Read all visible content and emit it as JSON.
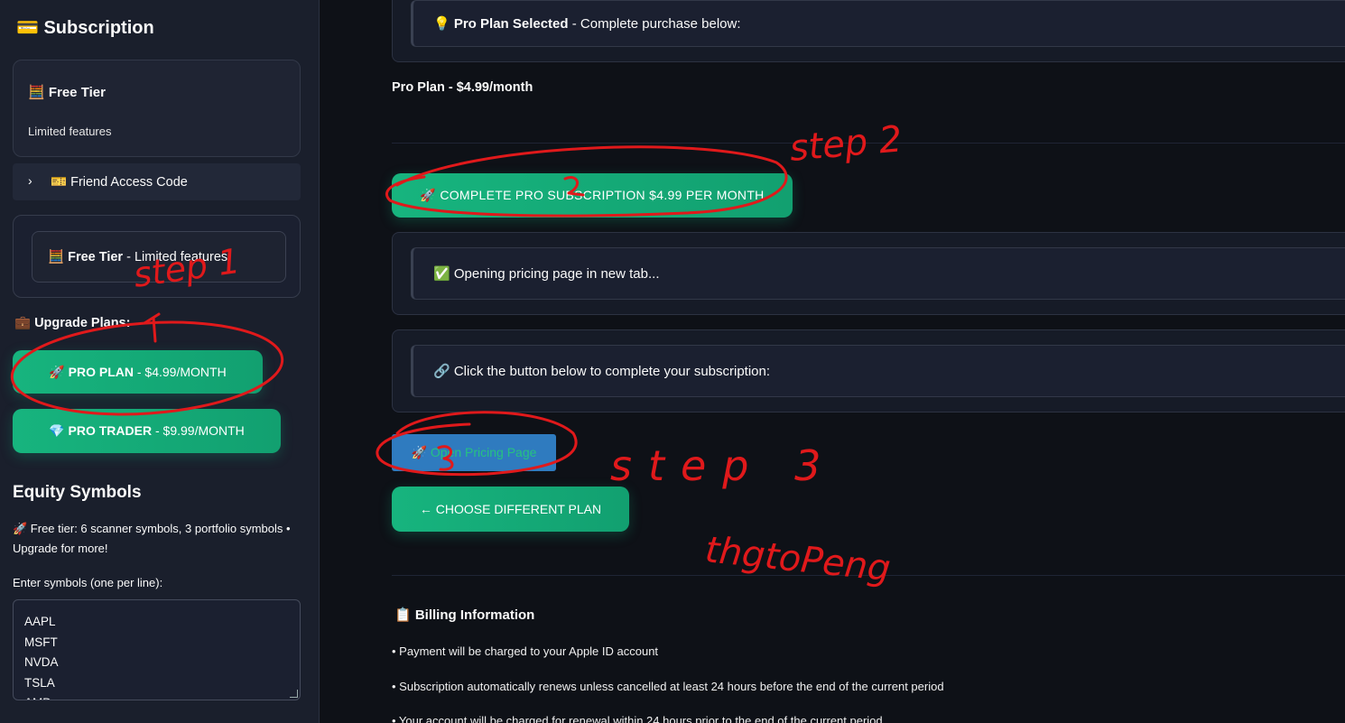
{
  "sidebar": {
    "title": "💳 Subscription",
    "free_card": {
      "title": "🧮 Free Tier",
      "subtitle": "Limited features"
    },
    "friend_access": {
      "chevron": "›",
      "label": "🎫 Friend Access Code"
    },
    "tier_status": {
      "bold": "🧮 Free Tier",
      "rest": " - Limited features"
    },
    "upgrade_heading": "💼 Upgrade Plans:",
    "pro_plan": {
      "name": "🚀 PRO PLAN",
      "price": " - $4.99/MONTH"
    },
    "pro_trader": {
      "name": "💎 PRO TRADER",
      "price": " - $9.99/MONTH"
    },
    "equity": {
      "title": "Equity Symbols",
      "note": "🚀 Free tier: 6 scanner symbols, 3 portfolio symbols • Upgrade for more!",
      "input_label": "Enter symbols (one per line):",
      "symbols": [
        "AAPL",
        "MSFT",
        "NVDA",
        "TSLA",
        "AMD"
      ]
    }
  },
  "main": {
    "selected": {
      "bold": "💡 Pro Plan Selected",
      "rest": " - Complete purchase below:"
    },
    "pro_line": "Pro Plan - $4.99/month",
    "complete_button": "🚀 COMPLETE PRO SUBSCRIPTION $4.99 PER MONTH",
    "opening_msg": "✅ Opening pricing page in new tab...",
    "click_msg": "🔗 Click the button below to complete your subscription:",
    "open_pricing": "🚀 Open Pricing Page",
    "choose_different": "← CHOOSE DIFFERENT PLAN",
    "billing": {
      "title": "📋 Billing Information",
      "lines": [
        "• Payment will be charged to your Apple ID account",
        "• Subscription automatically renews unless cancelled at least 24 hours before the end of the current period",
        "• Your account will be charged for renewal within 24 hours prior to the end of the current period"
      ]
    }
  },
  "annotations": {
    "step1": "step 1",
    "step2": "step 2",
    "step3": "step 3",
    "handwriting": "thgtoPeng",
    "color": "#e0191b"
  },
  "colors": {
    "accent": "#16a874",
    "background": "#0e1117",
    "sidebar": "#1a1f2c",
    "link_button": "#2f7bbf"
  }
}
